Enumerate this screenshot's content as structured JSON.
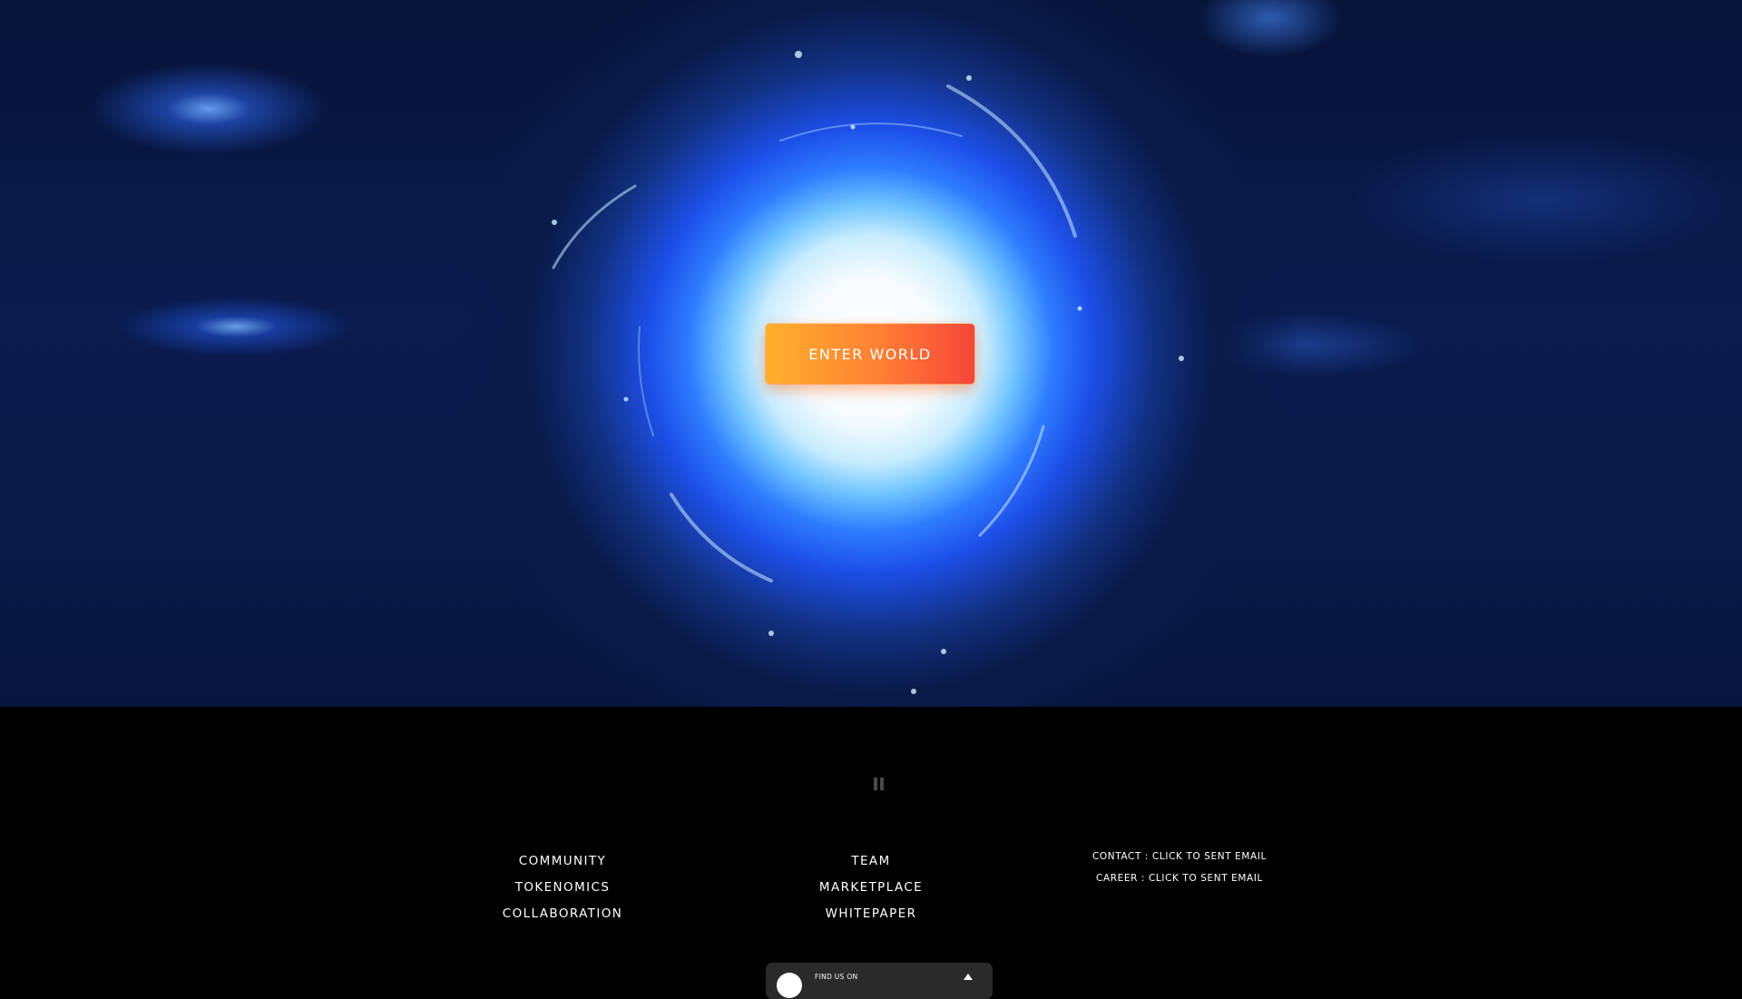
{
  "hero": {
    "enter_button_label": "ENTER WORLD"
  },
  "footer": {
    "left_links": [
      "COMMUNITY",
      "TOKENOMICS",
      "COLLABORATION"
    ],
    "middle_links": [
      "TEAM",
      "MARKETPLACE",
      "WHITEPAPER"
    ],
    "contact_links": [
      "CONTACT : CLICK TO SENT EMAIL",
      "CAREER : CLICK TO SENT EMAIL"
    ],
    "badge": {
      "text": "FIND US ON",
      "logo_icon": "store-logo-icon",
      "arrow_icon": "chevron-up-icon"
    }
  },
  "colors": {
    "button_start": "#ffb02c",
    "button_end": "#f4463a",
    "portal_core": "#ffffff",
    "portal_ring": "#1d4fe8",
    "background": "#000000"
  }
}
